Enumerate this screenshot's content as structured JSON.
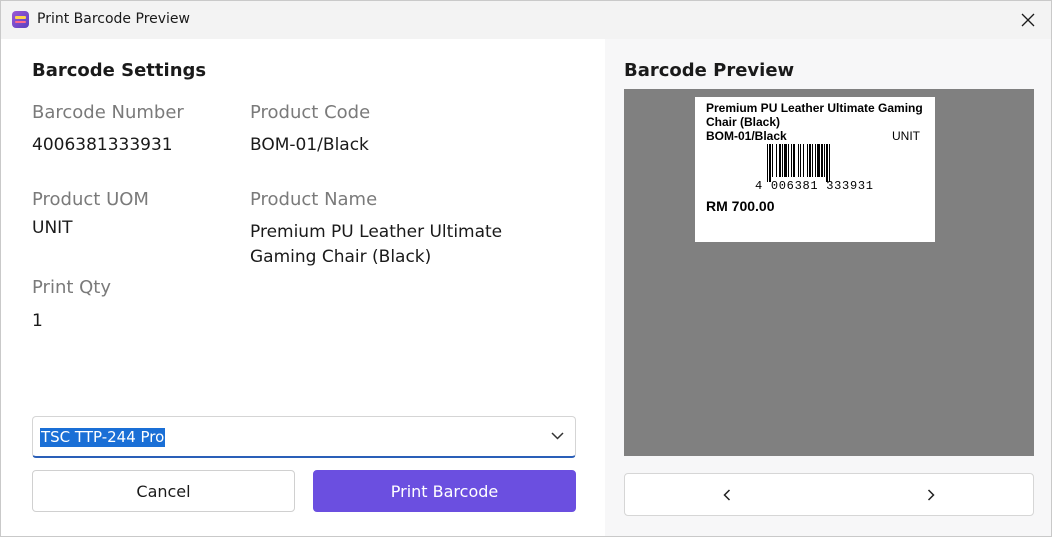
{
  "window": {
    "title": "Print Barcode Preview",
    "icons": {
      "app": "app-logo-icon",
      "close": "close-icon"
    }
  },
  "settings": {
    "heading": "Barcode Settings",
    "barcode_number": {
      "label": "Barcode Number",
      "value": "4006381333931"
    },
    "product_code": {
      "label": "Product Code",
      "value": "BOM-01/Black"
    },
    "product_uom": {
      "label": "Product UOM",
      "value": "UNIT"
    },
    "product_name": {
      "label": "Product Name",
      "value_line1": "Premium PU Leather Ultimate",
      "value_line2": "Gaming Chair (Black)"
    },
    "print_qty": {
      "label": "Print Qty",
      "value": "1"
    },
    "printer": {
      "selected": "TSC TTP-244 Pro",
      "icon": "chevron-down-icon"
    },
    "cancel_label": "Cancel",
    "print_label": "Print Barcode"
  },
  "preview": {
    "heading": "Barcode Preview",
    "label": {
      "name_line1": "Premium PU Leather Ultimate Gaming",
      "name_line2": "Chair (Black)",
      "code": "BOM-01/Black",
      "uom": "UNIT",
      "barcode_digits": "4 006381 333931",
      "price": "RM  700.00"
    },
    "icons": {
      "prev": "chevron-left-icon",
      "next": "chevron-right-icon"
    }
  },
  "colors": {
    "accent": "#6b4fe0",
    "selection": "#1a6fd6",
    "preview_bg": "#808080"
  }
}
